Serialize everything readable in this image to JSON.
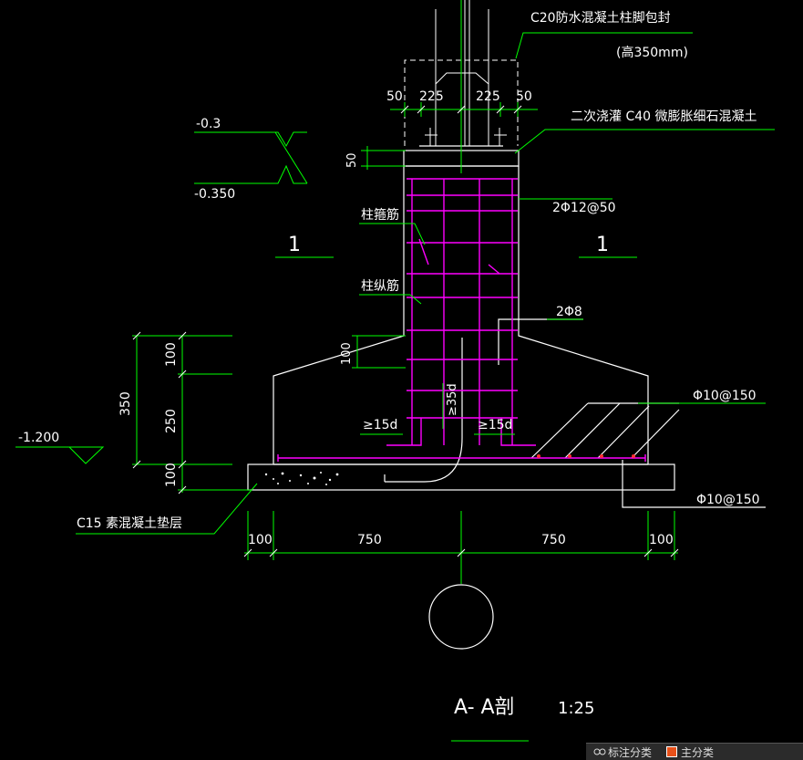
{
  "labels": {
    "waterproof_note": "C20防水混凝土柱脚包封",
    "waterproof_height": "(高350mm)",
    "grout_note": "二次浇灌  C40 微膨胀细石混凝土",
    "elev_top": "-0.3",
    "elev_mid": "-0.350",
    "elev_bottom": "-1.200",
    "stirrup": "柱箍筋",
    "longitudinal": "柱纵筋",
    "rebar_2phi12": "2Φ12@50",
    "rebar_2phi8": "2Φ8",
    "rebar_top_mesh": "Φ10@150",
    "rebar_bottom_mesh": "Φ10@150",
    "cushion": "C15  素混凝土垫层",
    "anchor_left": "≥15d",
    "anchor_right": "≥15d",
    "anchor_depth": "≥35d",
    "section_mark_left": "1",
    "section_mark_right": "1",
    "section_title": "A- A剖",
    "scale": "1:25"
  },
  "dimensions": {
    "top": [
      "50",
      "225",
      "225",
      "50"
    ],
    "grout_thickness": "50",
    "step_height": "100",
    "vertical": [
      "100",
      "250",
      "100"
    ],
    "total_height": "350",
    "bottom": [
      "100",
      "750",
      "750",
      "100"
    ]
  },
  "statusbar": {
    "item1": "标注分类",
    "item2": "主分类"
  },
  "colors": {
    "background": "#000000",
    "outline": "#ffffff",
    "dimension": "#00ff00",
    "rebar": "#ff00ff",
    "marker": "#ff3030"
  }
}
